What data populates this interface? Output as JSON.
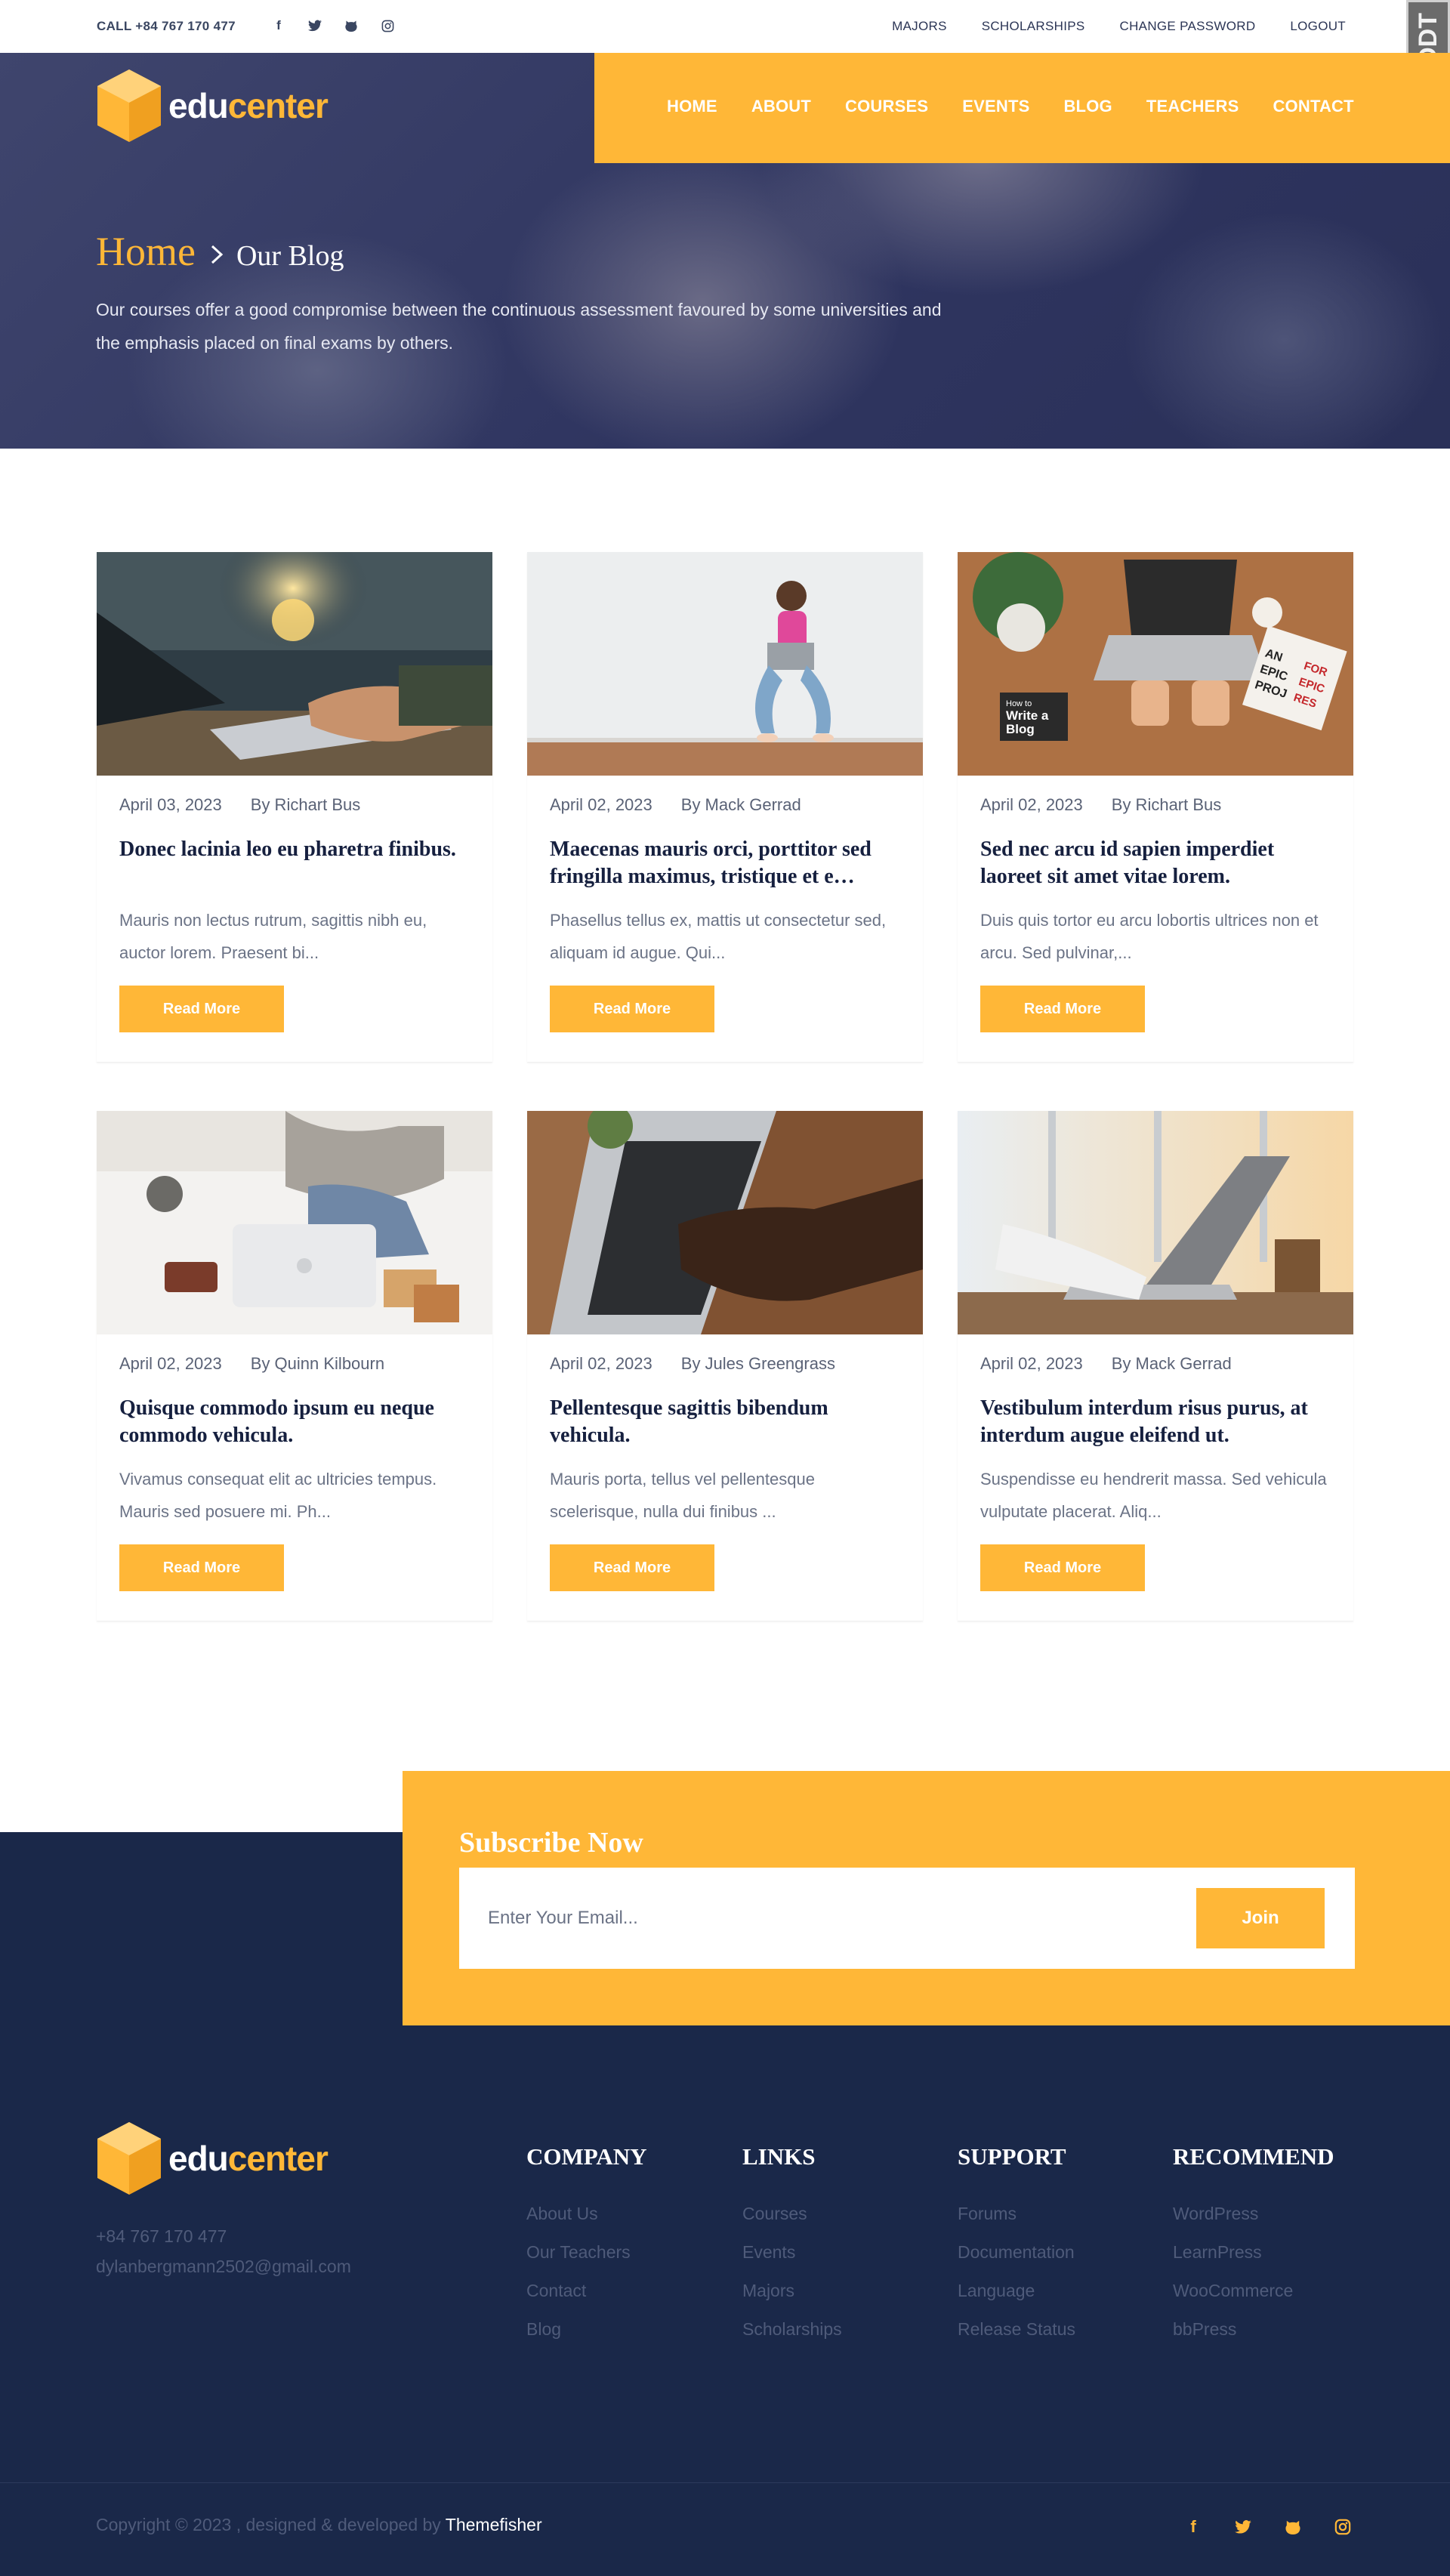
{
  "topbar": {
    "call": "CALL +84 767 170 477",
    "socials": [
      "facebook-icon",
      "twitter-icon",
      "github-icon",
      "instagram-icon"
    ],
    "links": [
      "MAJORS",
      "SCHOLARSHIPS",
      "CHANGE PASSWORD",
      "LOGOUT"
    ],
    "badge": "DDT"
  },
  "brand": {
    "edu": "edu",
    "center": "center"
  },
  "nav": [
    "HOME",
    "ABOUT",
    "COURSES",
    "EVENTS",
    "BLOG",
    "TEACHERS",
    "CONTACT"
  ],
  "hero": {
    "crumb_home": "Home",
    "crumb_current": "Our Blog",
    "description": "Our courses offer a good compromise between the continuous assessment favoured by some universities and the emphasis placed on final exams by others."
  },
  "posts": [
    {
      "date": "April 03, 2023",
      "author": "By Richart Bus",
      "title": "Donec lacinia leo eu pharetra finibus.",
      "excerpt": "Mauris non lectus rutrum, sagittis nibh eu, auctor lorem. Praesent bi...",
      "button": "Read More"
    },
    {
      "date": "April 02, 2023",
      "author": "By Mack Gerrad",
      "title": "Maecenas mauris orci, porttitor sed fringilla maximus, tristique et e…",
      "excerpt": "Phasellus tellus ex, mattis ut consectetur sed, aliquam id augue. Qui...",
      "button": "Read More"
    },
    {
      "date": "April 02, 2023",
      "author": "By Richart Bus",
      "title": "Sed nec arcu id sapien imperdiet laoreet sit amet vitae lorem.",
      "excerpt": "Duis quis tortor eu arcu lobortis ultrices non et arcu. Sed pulvinar,...",
      "button": "Read More"
    },
    {
      "date": "April 02, 2023",
      "author": "By Quinn Kilbourn",
      "title": "Quisque commodo ipsum eu neque commodo vehicula.",
      "excerpt": "Vivamus consequat elit ac ultricies tempus. Mauris sed posuere mi. Ph...",
      "button": "Read More"
    },
    {
      "date": "April 02, 2023",
      "author": "By Jules Greengrass",
      "title": "Pellentesque sagittis bibendum vehicula.",
      "excerpt": "Mauris porta, tellus vel pellentesque scelerisque, nulla dui finibus ...",
      "button": "Read More"
    },
    {
      "date": "April 02, 2023",
      "author": "By Mack Gerrad",
      "title": "Vestibulum interdum risus purus, at interdum augue eleifend ut.",
      "excerpt": "Suspendisse eu hendrerit massa. Sed vehicula vulputate placerat. Aliq...",
      "button": "Read More"
    }
  ],
  "post_image_text": {
    "line1": "How to",
    "line2": "Write a",
    "line3": "Blog",
    "card1": "AN",
    "card2": "EPIC",
    "card3": "PROJ",
    "card4": "FOR",
    "card5": "EPIC",
    "card6": "RES"
  },
  "subscribe": {
    "title": "Subscribe Now",
    "placeholder": "Enter Your Email...",
    "button": "Join"
  },
  "footer": {
    "phone": "+84 767 170 477",
    "email": "dylanbergmann2502@gmail.com",
    "columns": [
      {
        "heading": "COMPANY",
        "links": [
          "About Us",
          "Our Teachers",
          "Contact",
          "Blog"
        ]
      },
      {
        "heading": "LINKS",
        "links": [
          "Courses",
          "Events",
          "Majors",
          "Scholarships"
        ]
      },
      {
        "heading": "SUPPORT",
        "links": [
          "Forums",
          "Documentation",
          "Language",
          "Release Status"
        ]
      },
      {
        "heading": "RECOMMEND",
        "links": [
          "WordPress",
          "LearnPress",
          "WooCommerce",
          "bbPress"
        ]
      }
    ],
    "copyright": "Copyright © 2023 , designed & developed by ",
    "copyright_brand": "Themefisher",
    "socials": [
      "facebook-icon",
      "twitter-icon",
      "github-icon",
      "instagram-icon"
    ]
  },
  "colors": {
    "accent": "#ffb737",
    "navy": "#1a2849",
    "text": "#16203f"
  }
}
